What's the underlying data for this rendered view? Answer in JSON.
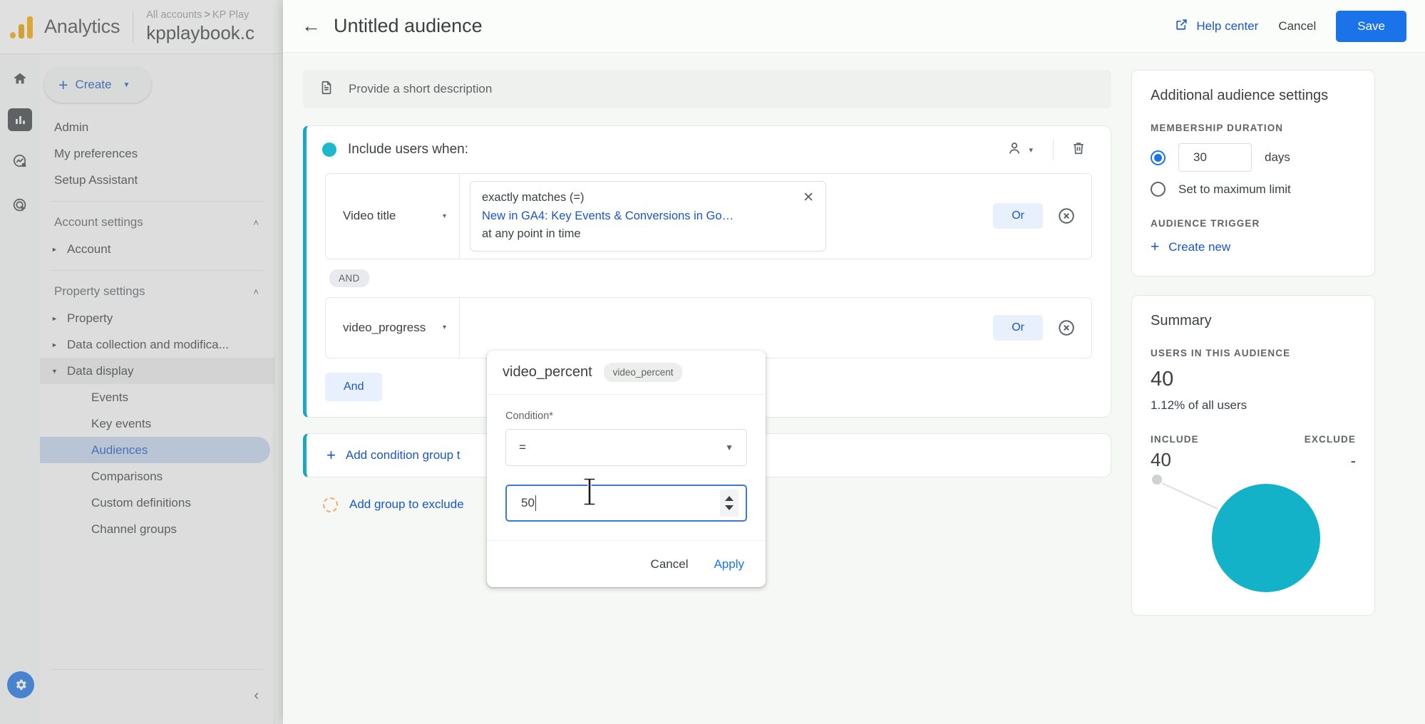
{
  "app": {
    "brand": "Analytics",
    "logo_icon": "analytics-bars-logo",
    "breadcrumb": "All accounts > KP Play",
    "breadcrumb_sep": ">",
    "breadcrumb_root": "All accounts",
    "breadcrumb_child": "KP Play",
    "property": "kpplaybook.c"
  },
  "rail": [
    {
      "icon": "home-icon",
      "selected": false
    },
    {
      "icon": "reports-bar-chart-icon",
      "selected": true
    },
    {
      "icon": "explore-icon",
      "selected": false
    },
    {
      "icon": "advertising-target-icon",
      "selected": false
    }
  ],
  "rail_gear_icon": "gear-icon",
  "nav": {
    "create_label": "Create",
    "create_plus": "+",
    "top_items": [
      "Admin",
      "My preferences",
      "Setup Assistant"
    ],
    "sections": [
      {
        "label": "Account settings",
        "chevron": "˄",
        "children": [
          {
            "label": "Account",
            "expanded": false
          }
        ]
      },
      {
        "label": "Property settings",
        "chevron": "˄",
        "children": [
          {
            "label": "Property",
            "expanded": false
          },
          {
            "label": "Data collection and modifica...",
            "expanded": false
          },
          {
            "label": "Data display",
            "expanded": true
          }
        ]
      }
    ],
    "data_display_leaves": [
      {
        "label": "Events",
        "selected": false
      },
      {
        "label": "Key events",
        "selected": false
      },
      {
        "label": "Audiences",
        "selected": true
      },
      {
        "label": "Comparisons",
        "selected": false
      },
      {
        "label": "Custom definitions",
        "selected": false
      },
      {
        "label": "Channel groups",
        "selected": false
      }
    ],
    "collapse_icon": "chevron-left-icon"
  },
  "builder": {
    "back_icon": "back-arrow-icon",
    "title": "Untitled audience",
    "help_label": "Help center",
    "help_icon": "external-link-icon",
    "cancel_label": "Cancel",
    "save_label": "Save",
    "description_placeholder": "Provide a short description",
    "description_icon": "description-document-icon",
    "include": {
      "label": "Include users when:",
      "scope_icon": "person-icon",
      "scope_caret": "▾",
      "delete_icon": "trash-icon",
      "conditions": [
        {
          "dimension": "Video title",
          "caret": "▾",
          "match_line": "exactly matches (=)",
          "value_line": "New in GA4: Key Events & Conversions in Go…",
          "time_line": "at any point in time",
          "remove_chip_icon": "close-x-icon",
          "or_label": "Or",
          "remove_icon": "circle-close-icon"
        },
        {
          "dimension": "video_progress",
          "caret": "▾",
          "match_line": "",
          "value_line": "",
          "time_line": "",
          "or_label": "Or",
          "remove_icon": "circle-close-icon"
        }
      ],
      "and_pill": "AND",
      "and_button": "And"
    },
    "add_condition_group": "Add condition group t",
    "add_condition_plus": "+",
    "add_group_to_exclude": "Add group to exclude"
  },
  "popover": {
    "title": "video_percent",
    "tag": "video_percent",
    "condition_label": "Condition*",
    "operator": "=",
    "operator_caret": "▾",
    "value": "50",
    "spinner_icon": "number-spinner-icon",
    "cancel_label": "Cancel",
    "apply_label": "Apply"
  },
  "side": {
    "settings_title": "Additional audience settings",
    "membership_label": "MEMBERSHIP DURATION",
    "duration_value": "30",
    "duration_unit": "days",
    "max_limit_label": "Set to maximum limit",
    "duration_selected": true,
    "trigger_label": "AUDIENCE TRIGGER",
    "create_new_label": "Create new",
    "create_new_plus": "+",
    "summary_title": "Summary",
    "users_label": "USERS IN THIS AUDIENCE",
    "users_value": "40",
    "users_pct": "1.12% of all users",
    "include_label": "INCLUDE",
    "exclude_label": "EXCLUDE",
    "include_value": "40",
    "exclude_value": "-"
  },
  "colors": {
    "accent_blue": "#1a73e8",
    "link_blue": "#1a56c4",
    "teal": "#13b2c9",
    "include_border": "#1ca7bd",
    "canvas": "#f5f8f5"
  }
}
